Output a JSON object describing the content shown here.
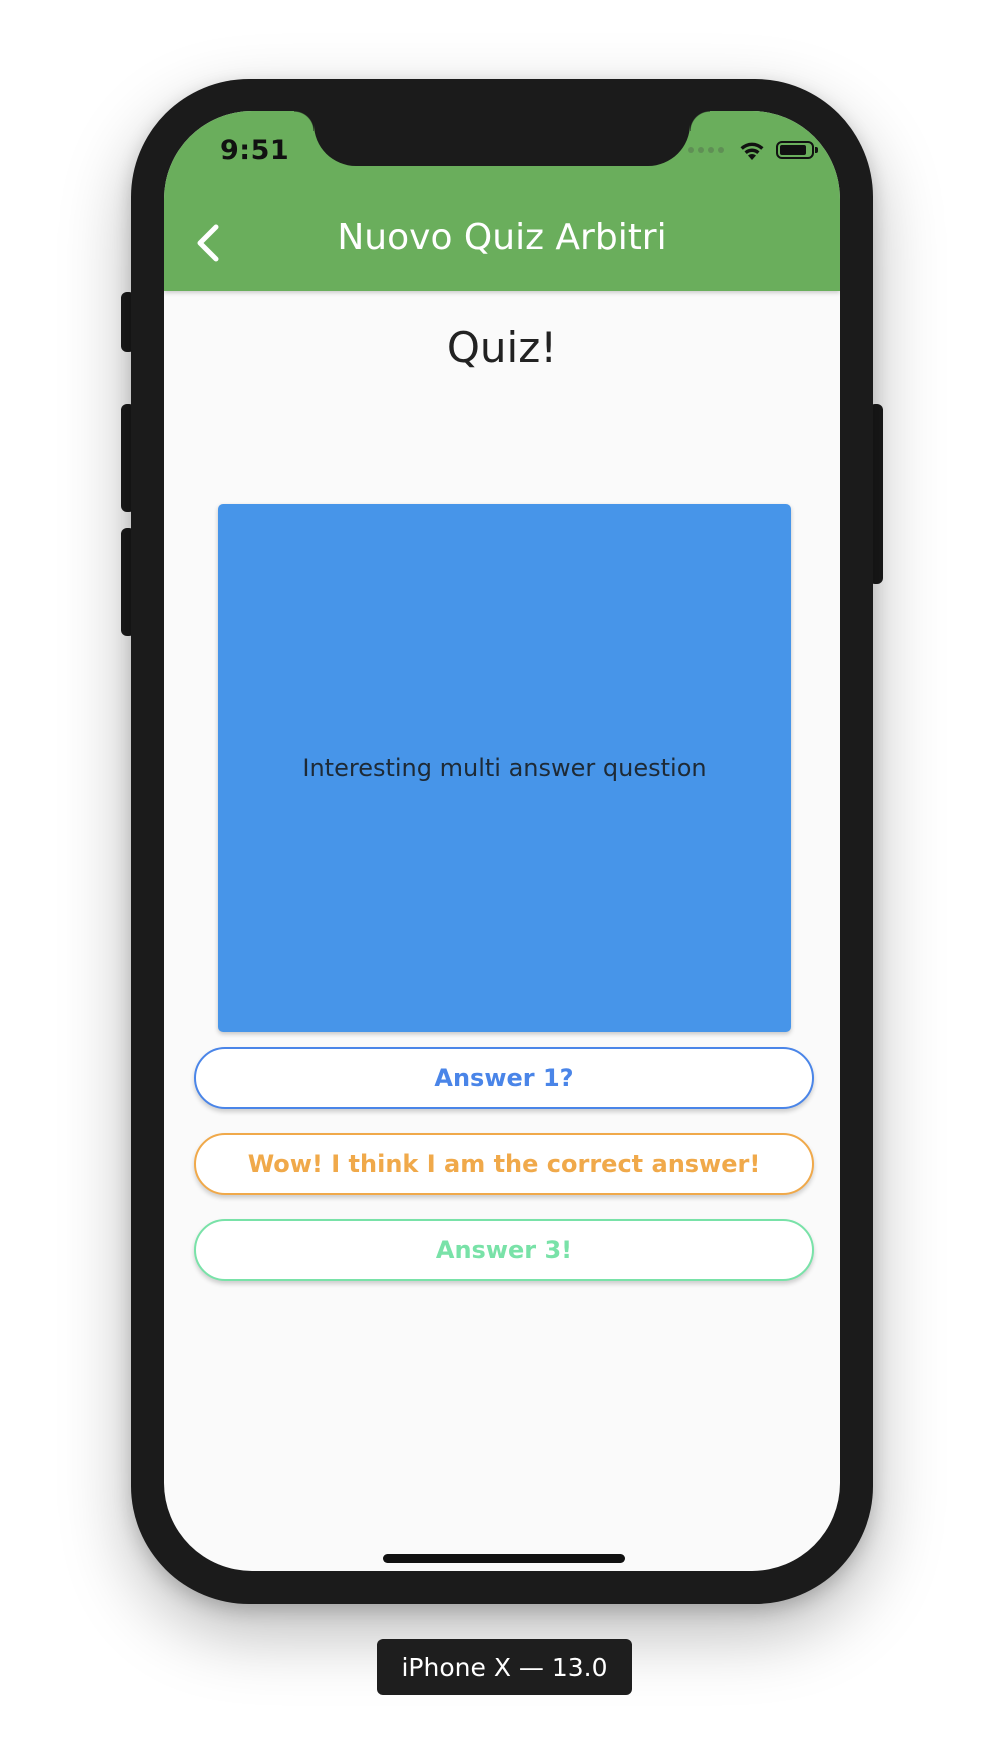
{
  "status_bar": {
    "time": "9:51",
    "icons": [
      "signal-icon",
      "wifi-icon",
      "battery-icon"
    ]
  },
  "app_bar": {
    "title": "Nuovo Quiz Arbitri",
    "back_icon": "chevron-left-icon",
    "color": "#6aae5c"
  },
  "page": {
    "title": "Quiz!"
  },
  "card": {
    "question": "Interesting multi answer question",
    "colors": [
      "#4795e9",
      "#69ae5b",
      "#8c37ab"
    ]
  },
  "answers": [
    {
      "label": "Answer 1?",
      "color": "#4a85e8"
    },
    {
      "label": "Wow! I think I am the correct answer!",
      "color": "#f0a94a"
    },
    {
      "label": "Answer 3!",
      "color": "#79e2a8"
    }
  ],
  "device_label": "iPhone X — 13.0"
}
